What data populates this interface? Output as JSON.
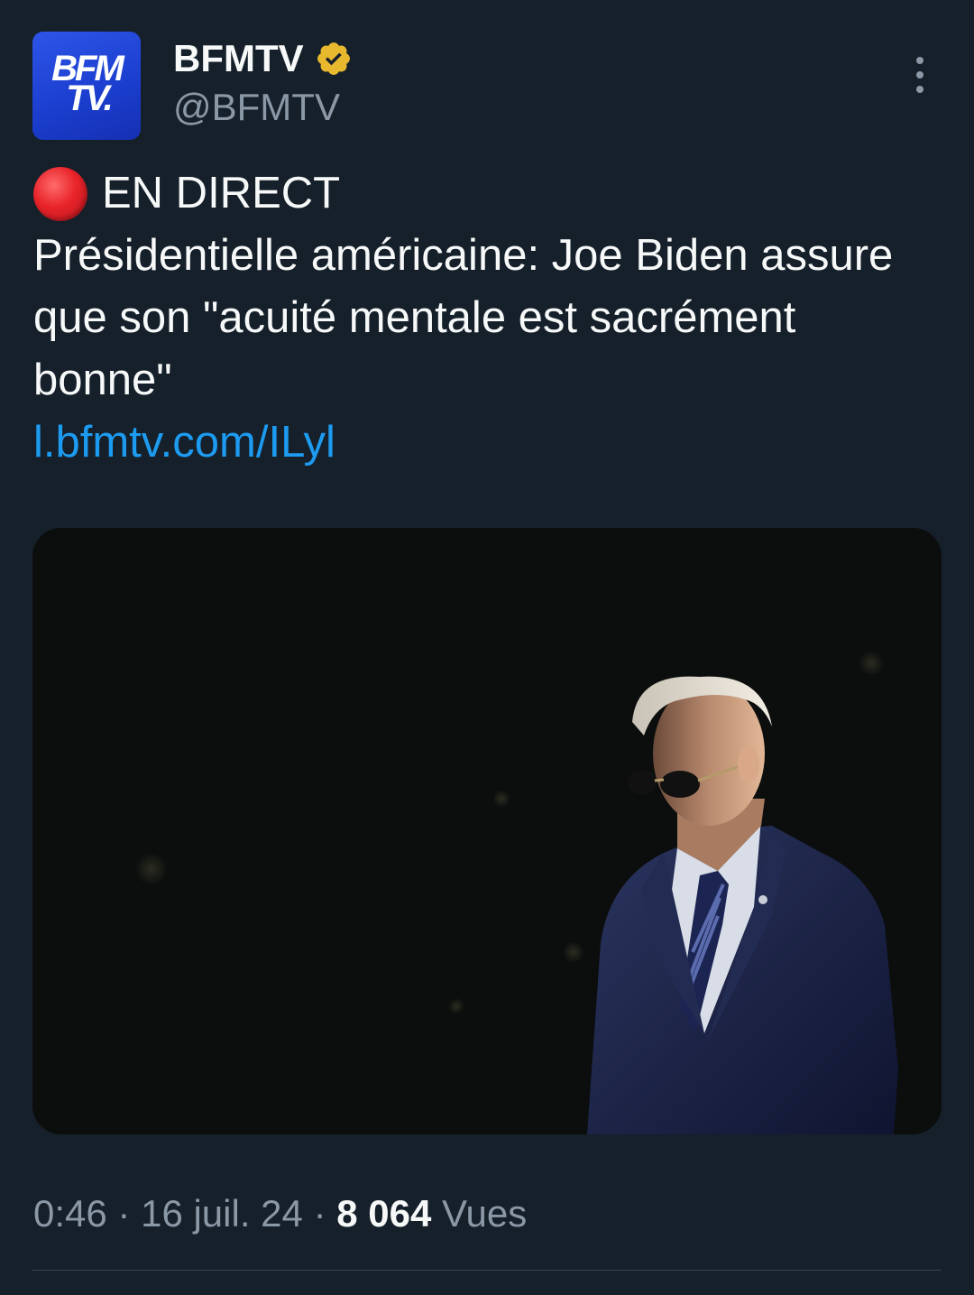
{
  "author": {
    "avatar_text_line1": "BFM",
    "avatar_text_line2": "TV.",
    "display_name": "BFMTV",
    "handle": "@BFMTV",
    "verified_badge_icon": "verified-badge-icon",
    "verified_color": "#e8b92e"
  },
  "tweet": {
    "live_icon": "red-circle-icon",
    "live_label": "EN DIRECT",
    "body": "Présidentielle américaine: Joe Biden assure que son \"acuité mentale est sacrément bonne\"",
    "link": "l.bfmtv.com/ILyl"
  },
  "meta": {
    "time": "0:46",
    "separator": "·",
    "date": "16 juil. 24",
    "views_count": "8 064",
    "views_label": "Vues"
  },
  "colors": {
    "background": "#15202b",
    "link": "#1d9bf0",
    "secondary_text": "#8b98a5"
  }
}
